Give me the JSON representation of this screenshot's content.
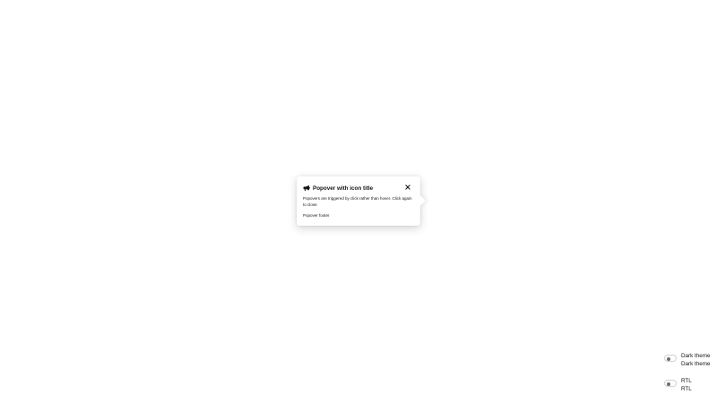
{
  "popover": {
    "title": "Popover with icon title",
    "title_icon": "bullhorn-icon",
    "body": "Popovers are triggered by click rather than hover. Click again to close.",
    "footer": "Popover footer",
    "close_icon": "close-icon"
  },
  "toggles": [
    {
      "label": "Dark theme",
      "label_off": "Dark theme",
      "checked": false
    },
    {
      "label": "RTL",
      "label_off": "RTL",
      "checked": false
    }
  ],
  "colors": {
    "text": "#151515",
    "knob": "#6a6e73",
    "toggle_border": "#d2d2d2"
  }
}
